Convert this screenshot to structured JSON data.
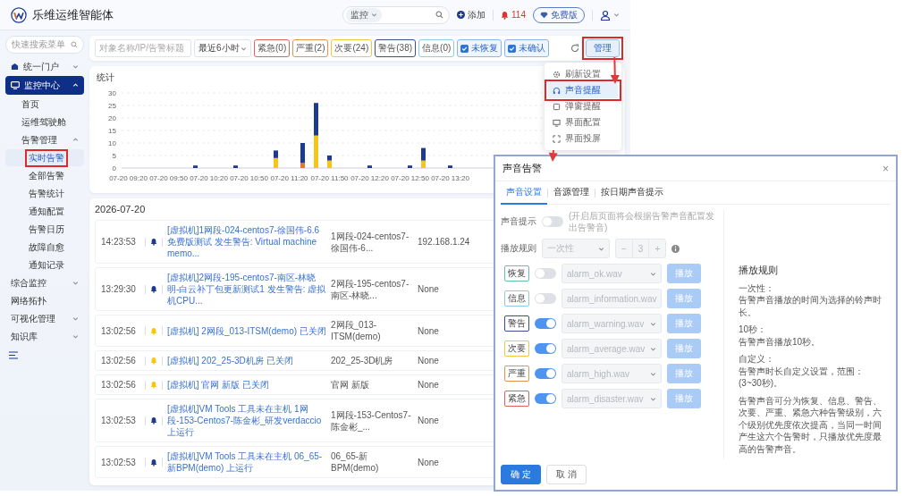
{
  "header": {
    "title": "乐维运维智能体",
    "search_scope": "监控",
    "add_label": "添加",
    "alert_count": "114",
    "plan_badge": "免费版"
  },
  "sidebar": {
    "search": {
      "placeholder": "快速搜索菜单"
    },
    "items": [
      {
        "label": "统一门户",
        "selected": false,
        "expanded": false
      },
      {
        "label": "监控中心",
        "selected": true,
        "expanded": true,
        "children": [
          {
            "label": "首页",
            "selected": false
          },
          {
            "label": "运维驾驶舱",
            "selected": false
          },
          {
            "label": "告警管理",
            "selected": false,
            "expanded": true,
            "children": [
              {
                "label": "实时告警",
                "selected": true,
                "highlighted": true
              },
              {
                "label": "全部告警",
                "selected": false,
                "highlighted": false
              },
              {
                "label": "告警统计",
                "selected": false,
                "highlighted": false
              },
              {
                "label": "通知配置",
                "selected": false,
                "highlighted": false
              },
              {
                "label": "告警日历",
                "selected": false,
                "highlighted": false
              },
              {
                "label": "故障自愈",
                "selected": false,
                "highlighted": false
              },
              {
                "label": "通知记录",
                "selected": false,
                "highlighted": false
              }
            ]
          }
        ]
      },
      {
        "label": "综合监控",
        "selected": false,
        "expanded": false
      },
      {
        "label": "网络拓扑",
        "selected": false
      },
      {
        "label": "可视化管理",
        "selected": false,
        "expanded": false
      },
      {
        "label": "知识库",
        "selected": false,
        "expanded": false
      }
    ]
  },
  "filters": {
    "keyword": {
      "placeholder": "对象名称/IP/告警标题"
    },
    "time_range": "最近6小时",
    "levels": [
      {
        "label": "紧急(0)",
        "color": "#e0605a"
      },
      {
        "label": "严重(2)",
        "color": "#e8924a"
      },
      {
        "label": "次要(24)",
        "color": "#f0c840"
      },
      {
        "label": "警告(38)",
        "color": "#3a4f8f"
      },
      {
        "label": "信息(0)",
        "color": "#8ccbe8"
      }
    ],
    "toggles": [
      {
        "label": "未恢复",
        "checked": true
      },
      {
        "label": "未确认",
        "checked": true
      }
    ],
    "manage_button": {
      "label": "管理",
      "highlighted": true
    }
  },
  "manage_menu": [
    {
      "label": "刷新设置",
      "selected": false,
      "highlighted": false
    },
    {
      "label": "声音提醒",
      "selected": true,
      "highlighted": true
    },
    {
      "label": "弹窗提醒",
      "selected": false,
      "highlighted": false
    },
    {
      "label": "界面配置",
      "selected": false,
      "highlighted": false
    },
    {
      "label": "界面投屏",
      "selected": false,
      "highlighted": false
    }
  ],
  "chart": {
    "title": "统计",
    "chart_data": {
      "type": "bar",
      "stacked": true,
      "grid": true,
      "categories": [
        "07-20 09:20",
        null,
        null,
        "07-20 09:50",
        null,
        null,
        "07-20 10:20",
        null,
        null,
        "07-20 10:50",
        null,
        null,
        "07-20 11:20",
        null,
        null,
        "07-20 11:50",
        null,
        null,
        "07-20 12:20",
        null,
        null,
        "07-20 12:50",
        null,
        null,
        "07-20 13:20"
      ],
      "series": [
        {
          "color": "#e8772e",
          "values": [
            0,
            0,
            0,
            0,
            0,
            0,
            0,
            0,
            0,
            0,
            0,
            0,
            0,
            2,
            0,
            0,
            0,
            0,
            0,
            0,
            0,
            0,
            0,
            0,
            0
          ]
        },
        {
          "color": "#f5c518",
          "values": [
            0,
            0,
            0,
            0,
            0,
            0,
            0,
            0,
            0,
            0,
            0,
            4,
            0,
            0,
            13,
            3,
            0,
            0,
            0,
            0,
            0,
            0,
            3,
            0,
            0
          ]
        },
        {
          "color": "#1d3a8f",
          "values": [
            0,
            0,
            0,
            0,
            0,
            1,
            0,
            0,
            1,
            0,
            0,
            3,
            0,
            8,
            13,
            2,
            0,
            0,
            1,
            0,
            0,
            1,
            5,
            0,
            1
          ]
        }
      ],
      "ylim": [
        0,
        30
      ],
      "yticks": [
        0,
        5,
        10,
        15,
        20,
        25,
        30
      ]
    }
  },
  "alerts": {
    "date": "2026-07-20",
    "rows": [
      {
        "time": "14:23:53",
        "color": "#1d3a8f",
        "title": "[虚拟机]1网段-024-centos7-徐国伟-6.6免费版测试 发生警告: Virtual machine memo...",
        "object": "1网段-024-centos7-徐国伟-6...",
        "ip": "192.168.1.24"
      },
      {
        "time": "13:29:30",
        "color": "#1d3a8f",
        "title": "[虚拟机]2网段-195-centos7-南区-林晓明-白云补丁包更新测试1 发生警告: 虚拟机CPU...",
        "object": "2网段-195-centos7-南区-林晓...",
        "ip": "None"
      },
      {
        "time": "13:02:56",
        "color": "#f5c518",
        "title": "[虚拟机] 2网段_013-ITSM(demo) 已关闭",
        "object": "2网段_013-ITSM(demo)",
        "ip": "None"
      },
      {
        "time": "13:02:56",
        "color": "#f5c518",
        "title": "[虚拟机] 202_25-3D机房 已关闭",
        "object": "202_25-3D机房",
        "ip": "None"
      },
      {
        "time": "13:02:56",
        "color": "#f5c518",
        "title": "[虚拟机] 官网 新版 已关闭",
        "object": "官网 新版",
        "ip": "None"
      },
      {
        "time": "13:02:53",
        "color": "#1d3a8f",
        "title": "[虚拟机]VM Tools 工具未在主机 1网段-153-Centos7-陈金彬_研发verdaccio 上运行",
        "object": "1网段-153-Centos7-陈金彬_...",
        "ip": "None"
      },
      {
        "time": "13:02:53",
        "color": "#1d3a8f",
        "title": "[虚拟机]VM Tools 工具未在主机 06_65-新BPM(demo) 上运行",
        "object": "06_65-新BPM(demo)",
        "ip": "None"
      }
    ]
  },
  "dialog": {
    "title": "声音告警",
    "close": "×",
    "tabs": [
      {
        "label": "声音设置",
        "selected": true
      },
      {
        "label": "音源管理",
        "selected": false
      },
      {
        "label": "按日期声音提示",
        "selected": false
      }
    ],
    "sound_hint": {
      "label": "声音提示",
      "on": false,
      "note": "(开启后页面将会根据告警声音配置发出告警音)"
    },
    "play_rule": {
      "label": "播放规则",
      "value": "一次性",
      "decrement": "−",
      "count": "3",
      "increment": "+",
      "disabled": true
    },
    "levels": [
      {
        "label": "恢复",
        "color": "#5cc4b0",
        "on": false,
        "sound": "alarm_ok.wav",
        "play": "播放",
        "disabled": true
      },
      {
        "label": "信息",
        "color": "#8ccbe8",
        "on": false,
        "sound": "alarm_information.wav",
        "play": "播放",
        "disabled": true
      },
      {
        "label": "警告",
        "color": "#3a4f8f",
        "on": true,
        "sound": "alarm_warning.wav",
        "play": "播放",
        "disabled": true
      },
      {
        "label": "次要",
        "color": "#f0c840",
        "on": true,
        "sound": "alarm_average.wav",
        "play": "播放",
        "disabled": true
      },
      {
        "label": "严重",
        "color": "#e8924a",
        "on": true,
        "sound": "alarm_high.wav",
        "play": "播放",
        "disabled": true
      },
      {
        "label": "紧急",
        "color": "#e0605a",
        "on": true,
        "sound": "alarm_disaster.wav",
        "play": "播放",
        "disabled": true
      }
    ],
    "help": {
      "title": "播放规则",
      "entries": [
        {
          "term": "一次性：",
          "text": "告警声音播放的时间为选择的铃声时长。"
        },
        {
          "term": "10秒：",
          "text": "告警声音播放10秒。"
        },
        {
          "term": "自定义：",
          "text": "告警声时长自定义设置，范围：(3~30秒)。"
        }
      ],
      "note": "告警声音可分为恢复、信息、警告、次要、严重、紧急六种告警级别，六个级别优先度依次提高，当同一时间产生这六个告警时，只播放优先度最高的告警声音。"
    },
    "buttons": [
      {
        "label": "确 定",
        "kind": "primary"
      },
      {
        "label": "取 消",
        "kind": "default"
      }
    ]
  }
}
